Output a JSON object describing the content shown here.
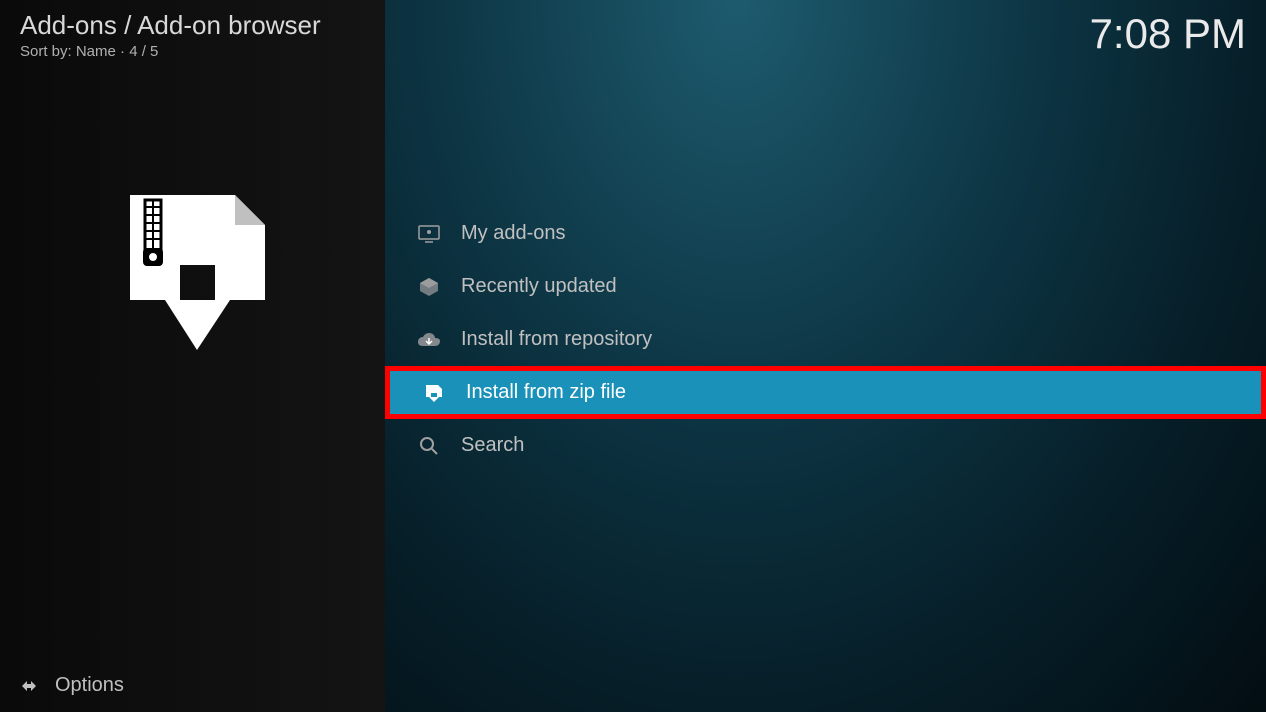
{
  "header": {
    "breadcrumb": "Add-ons / Add-on browser",
    "sort_label": "Sort by: Name  ·  4 / 5"
  },
  "clock": "7:08 PM",
  "menu": {
    "items": [
      {
        "label": "My add-ons",
        "icon": "monitor"
      },
      {
        "label": "Recently updated",
        "icon": "box"
      },
      {
        "label": "Install from repository",
        "icon": "cloud-download"
      },
      {
        "label": "Install from zip file",
        "icon": "zip-install",
        "selected": true,
        "highlighted": true
      },
      {
        "label": "Search",
        "icon": "search"
      }
    ]
  },
  "footer": {
    "options_label": "Options"
  }
}
